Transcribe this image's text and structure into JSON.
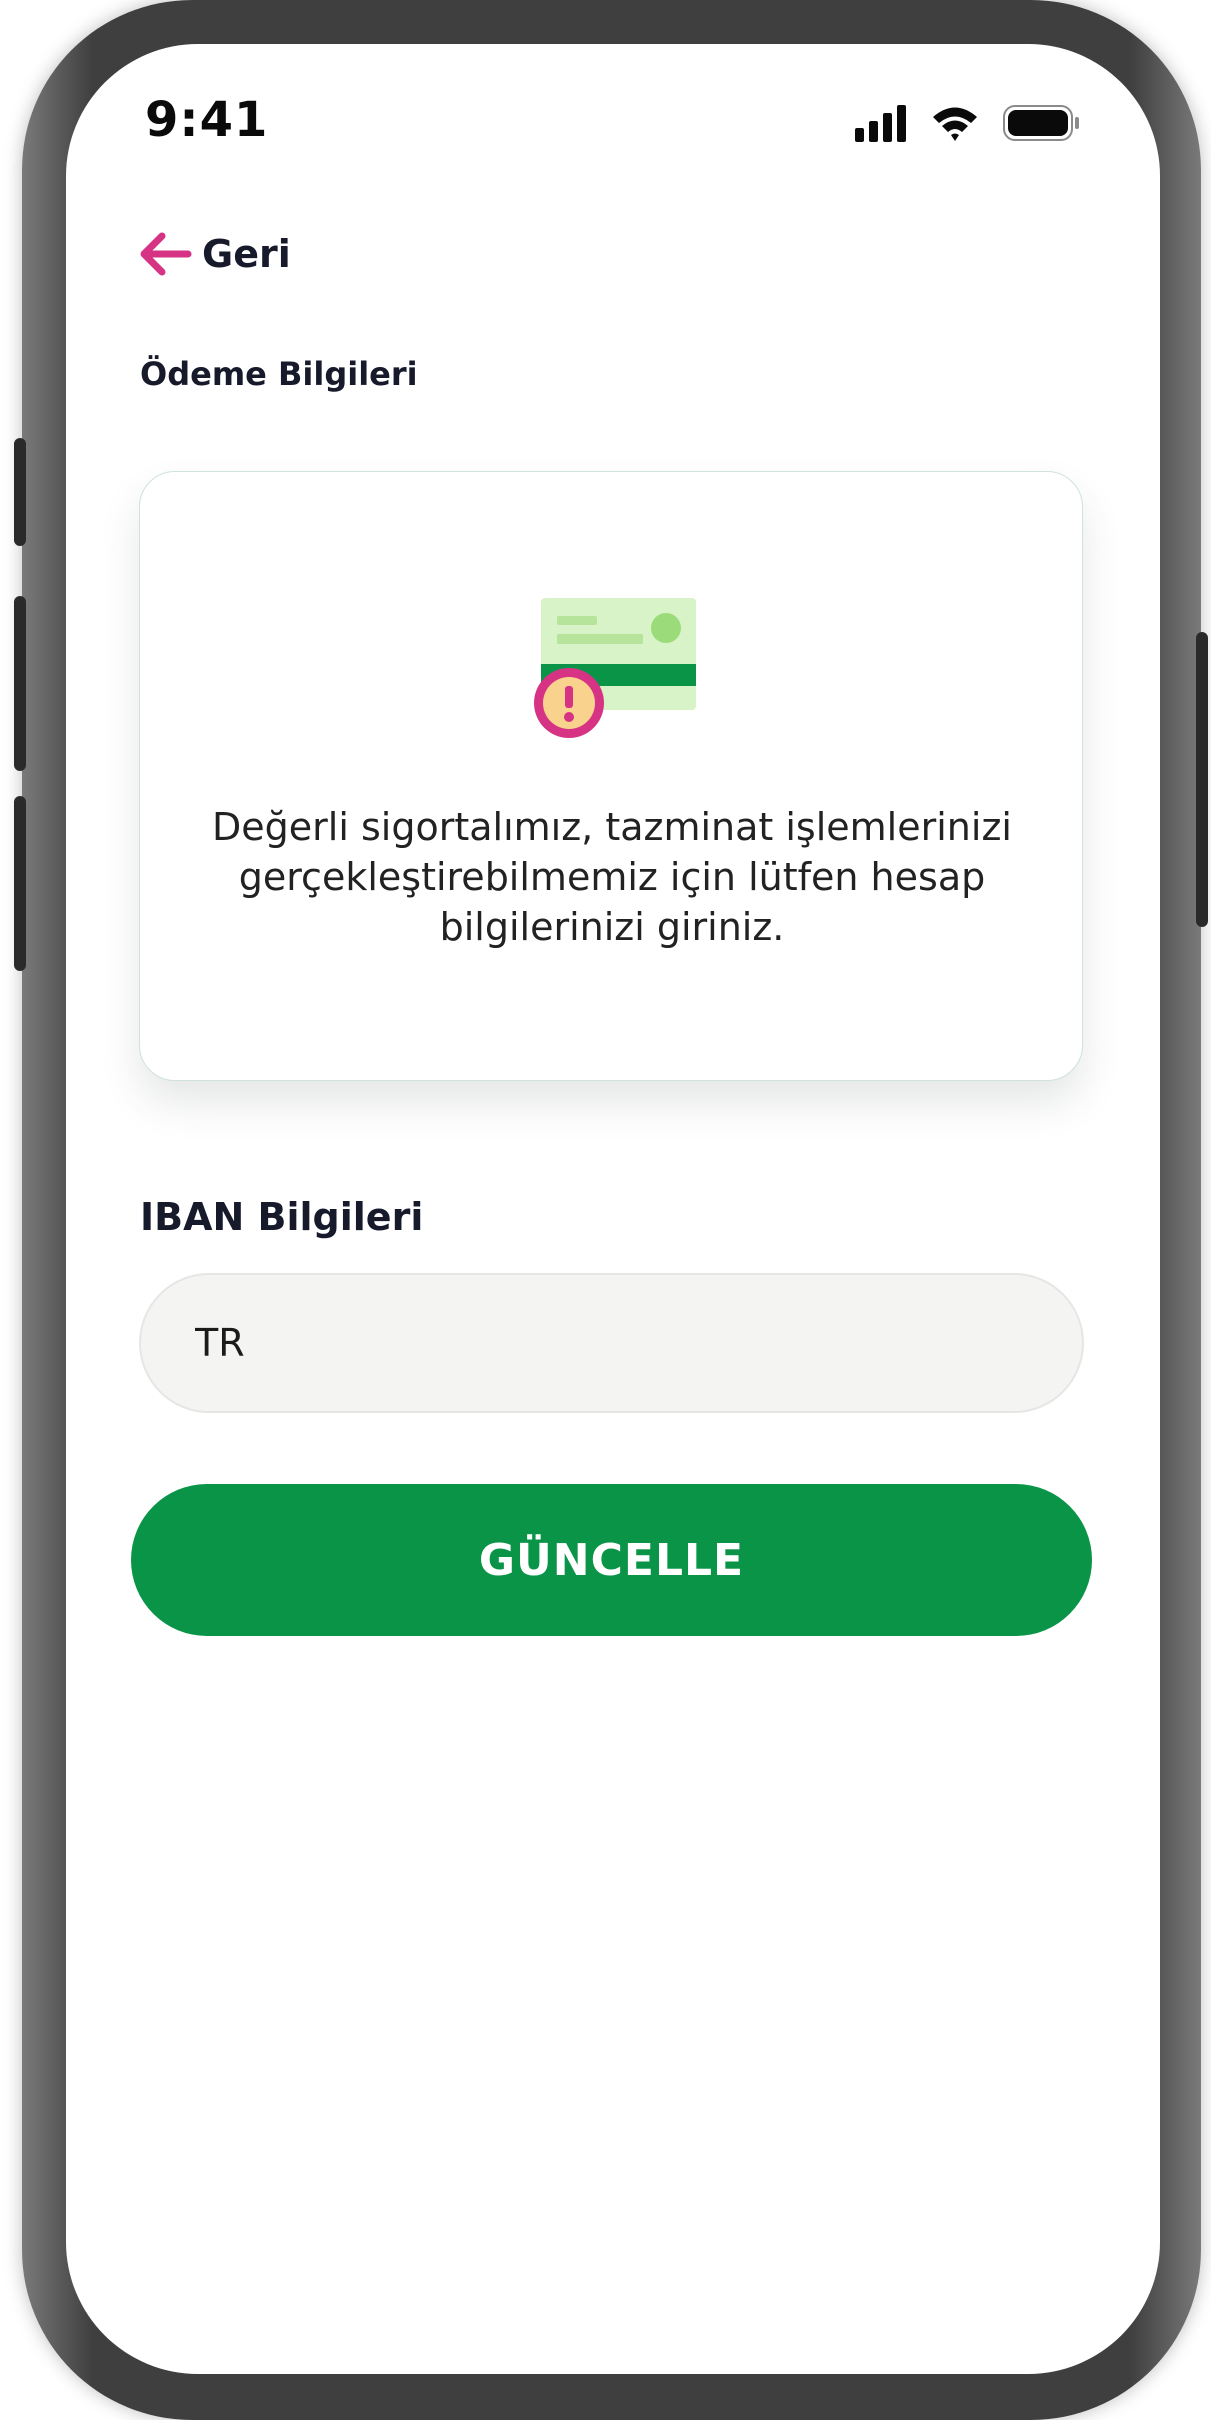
{
  "status_bar": {
    "time": "9:41",
    "signal_icon": "cellular-signal-icon",
    "wifi_icon": "wifi-icon",
    "battery_icon": "battery-icon"
  },
  "nav": {
    "back_label": "Geri",
    "back_icon": "arrow-left-icon"
  },
  "page": {
    "title": "Ödeme Bilgileri"
  },
  "info_card": {
    "illustration": "credit-card-warning-icon",
    "message": "Değerli sigortalımız, tazminat işlemlerinizi gerçekleştirebilmemiz için lütfen hesap bilgilerinizi giriniz."
  },
  "iban": {
    "label": "IBAN Bilgileri",
    "value": "TR"
  },
  "actions": {
    "update_label": "GÜNCELLE"
  },
  "colors": {
    "accent_pink": "#d63384",
    "primary_green": "#0a9447",
    "card_light_green": "#d8f3c8",
    "warning_yellow": "#f9d38e",
    "text_dark": "#161a2b"
  }
}
